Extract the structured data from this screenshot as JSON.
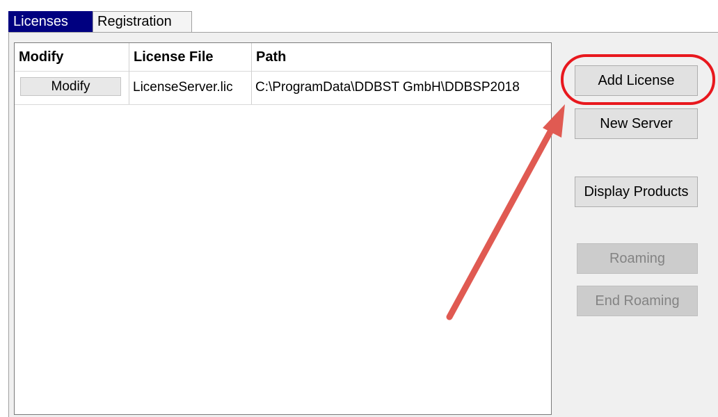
{
  "tabs": [
    {
      "label": "Licenses",
      "active": true
    },
    {
      "label": "Registration",
      "active": false
    }
  ],
  "grid": {
    "columns": [
      "Modify",
      "License File",
      "Path"
    ],
    "rows": [
      {
        "modify_button": "Modify",
        "license_file": "LicenseServer.lic",
        "path": "C:\\ProgramData\\DDBST GmbH\\DDBSP2018"
      }
    ]
  },
  "buttons": {
    "add_license": "Add License",
    "new_server": "New Server",
    "display_products": "Display Products",
    "roaming": "Roaming",
    "end_roaming": "End Roaming"
  },
  "annotation": {
    "color": "#e8181e",
    "arrow_color": "#e05a52"
  }
}
